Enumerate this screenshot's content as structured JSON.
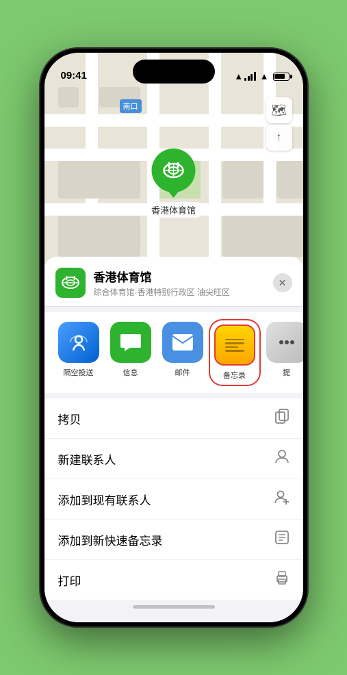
{
  "statusBar": {
    "time": "09:41",
    "locationIcon": "▶"
  },
  "map": {
    "stationLabel": "南口",
    "venueName": "香港体育馆",
    "controls": {
      "mapTypeIcon": "🗺",
      "locationIcon": "⬆"
    }
  },
  "sheet": {
    "venueIcon": "🏟",
    "venueName": "香港体育馆",
    "venueDesc": "综合体育馆·香港特别行政区 油尖旺区",
    "closeLabel": "✕",
    "shareItems": [
      {
        "id": "airdrop",
        "label": "隔空投送",
        "iconType": "airdrop"
      },
      {
        "id": "messages",
        "label": "信息",
        "iconType": "messages"
      },
      {
        "id": "mail",
        "label": "邮件",
        "iconType": "mail"
      },
      {
        "id": "notes",
        "label": "备忘录",
        "iconType": "notes"
      },
      {
        "id": "more",
        "label": "提",
        "iconType": "more"
      }
    ],
    "actionRows": [
      {
        "label": "拷贝",
        "iconType": "copy"
      },
      {
        "label": "新建联系人",
        "iconType": "person"
      },
      {
        "label": "添加到现有联系人",
        "iconType": "personadd"
      },
      {
        "label": "添加到新快速备忘录",
        "iconType": "note"
      },
      {
        "label": "打印",
        "iconType": "printer"
      }
    ]
  }
}
